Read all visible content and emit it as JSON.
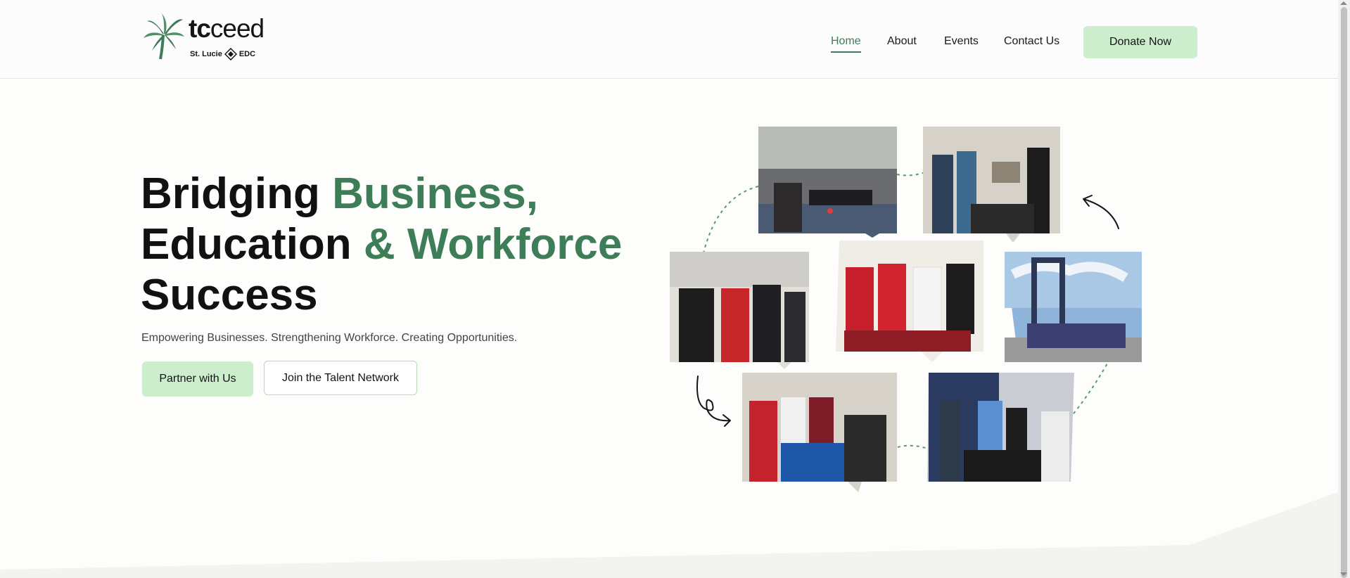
{
  "brand": {
    "name_bold": "tc",
    "name_rest": "ceed",
    "sub_left": "St. Lucie",
    "sub_right": "EDC",
    "logo_color": "#3f7c5a"
  },
  "nav": {
    "items": [
      {
        "label": "Home",
        "active": true
      },
      {
        "label": "About",
        "active": false
      },
      {
        "label": "Events",
        "active": false
      },
      {
        "label": "Contact Us",
        "active": false
      }
    ],
    "donate_label": "Donate Now"
  },
  "hero": {
    "line1_a": "Bridging ",
    "line1_b": "Business,",
    "line2_a": "Education ",
    "line2_b": "& Workforce",
    "line3": "Success",
    "tagline": "Empowering Businesses. Strengthening Workforce. Creating Opportunities.",
    "primary_cta": "Partner with Us",
    "secondary_cta": "Join the Talent Network"
  },
  "colors": {
    "accent_green": "#3d7d57",
    "button_green": "#cdeecd",
    "button_border": "#b5ddb5"
  },
  "icons": [
    "palm-tree-icon",
    "edc-diamond-icon",
    "curved-arrow-icon",
    "loop-arrow-icon"
  ]
}
